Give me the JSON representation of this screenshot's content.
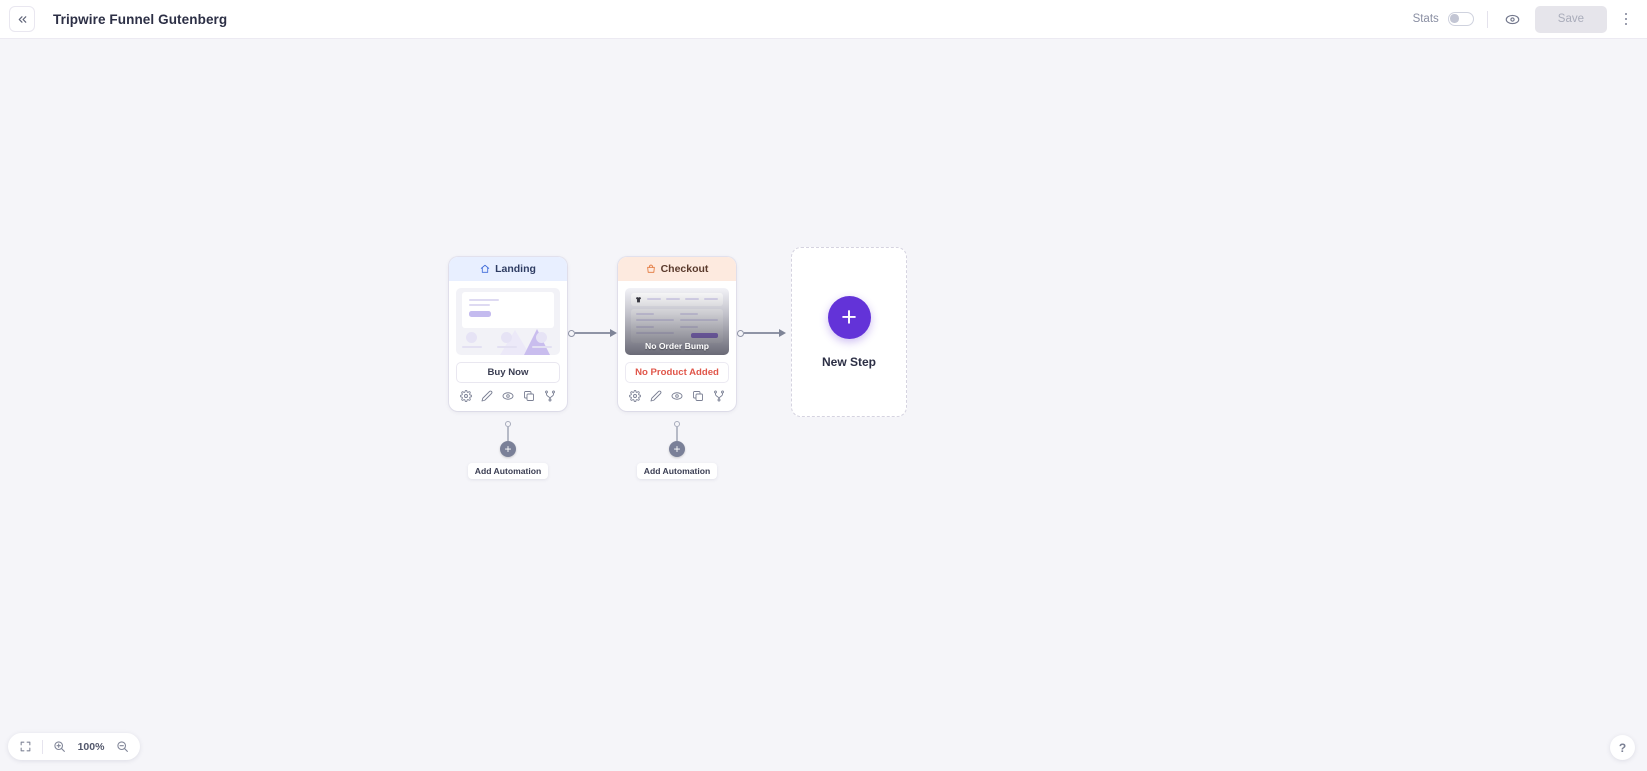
{
  "topbar": {
    "collapse_icon": "double-chevron-left-icon",
    "title": "Tripwire Funnel Gutenberg",
    "stats_label": "Stats",
    "stats_enabled": false,
    "preview_icon": "eye-icon",
    "save_label": "Save",
    "save_enabled": false,
    "more_icon": "kebab-menu-icon"
  },
  "flow": {
    "nodes": [
      {
        "id": "landing",
        "header_label": "Landing",
        "header_icon": "home-icon",
        "cta_label": "Buy Now",
        "cta_state": "normal",
        "automation_label": "Add Automation",
        "icons": [
          "gear-icon",
          "pencil-icon",
          "eye-icon",
          "duplicate-icon",
          "split-test-icon"
        ]
      },
      {
        "id": "checkout",
        "header_label": "Checkout",
        "header_icon": "shopping-bag-icon",
        "overlay_label": "No Order Bump",
        "cta_label": "No Product Added",
        "cta_state": "warning",
        "automation_label": "Add Automation",
        "icons": [
          "gear-icon",
          "pencil-icon",
          "eye-icon",
          "duplicate-icon",
          "split-test-icon"
        ]
      }
    ],
    "new_step": {
      "plus_glyph": "+",
      "label": "New Step"
    }
  },
  "bottom": {
    "fit_icon": "fit-to-screen-icon",
    "zoom_in_icon": "zoom-in-icon",
    "zoom_level": "100%",
    "zoom_out_icon": "zoom-out-icon",
    "help_glyph": "?"
  },
  "colors": {
    "accent_purple": "#6333d8",
    "landing_header": "#e8efff",
    "checkout_header": "#fdeadf",
    "warning_text": "#e0564a",
    "canvas_bg": "#f5f5f9"
  }
}
